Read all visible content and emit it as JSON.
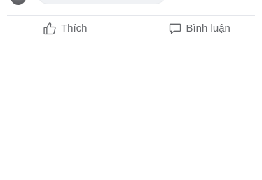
{
  "composer": {
    "avatar_icon": "user-avatar",
    "comment_placeholder": ""
  },
  "actions": {
    "like": {
      "label": "Thích",
      "icon": "thumbs-up-icon"
    },
    "comment": {
      "label": "Bình luận",
      "icon": "speech-bubble-icon"
    }
  },
  "colors": {
    "action_text": "#65676b",
    "divider": "#e4e6eb",
    "comment_box_bg": "#f0f2f5"
  }
}
